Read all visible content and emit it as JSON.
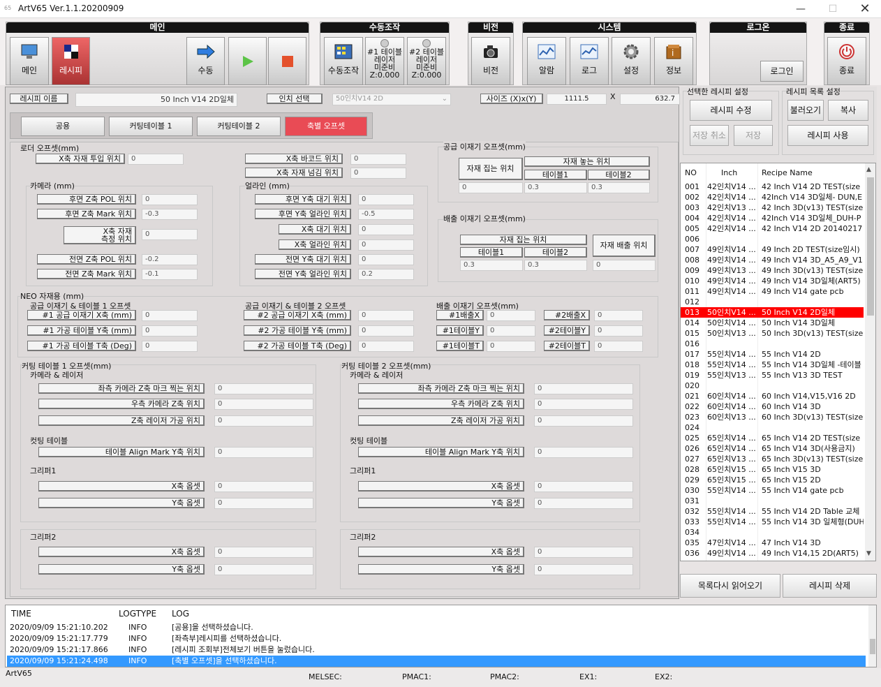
{
  "window": {
    "title": "ArtV65 Ver.1.1.20200909",
    "icon_text": "65"
  },
  "toolbar": {
    "main": {
      "header": "메인",
      "buttons": [
        "메인",
        "레시피",
        "수동"
      ]
    },
    "manual": {
      "header": "수동조작",
      "btn": "수동조작",
      "t1": [
        "#1 테이블",
        "레이저",
        "미준비",
        "Z:0.000"
      ],
      "t2": [
        "#2 테이블",
        "레이저",
        "미준비",
        "Z:0.000"
      ]
    },
    "vision": {
      "header": "비전",
      "btn": "비전"
    },
    "system": {
      "header": "시스템",
      "buttons": [
        "알람",
        "로그",
        "설정",
        "정보"
      ]
    },
    "login": {
      "header": "로그온",
      "btn": "로그인"
    },
    "exit": {
      "header": "종료",
      "btn": "종료"
    }
  },
  "recipe": {
    "name_label": "레시피 이름",
    "name_value": "50 Inch V14 2D일체",
    "inch_label": "인치 선택",
    "inch_value": "50인치V14 2D",
    "size_label": "사이즈 (X)x(Y)",
    "size_x": "1111.5",
    "size_sep": "X",
    "size_y": "632.7"
  },
  "tabs": [
    "공용",
    "커팅테이블 1",
    "커팅테이블 2",
    "축별 오프셋"
  ],
  "loader": {
    "title": "로더 오프셋(mm)",
    "x_in": "X축 자재 투입 위치",
    "x_in_v": "0",
    "x_bc": "X축 바코드 위치",
    "x_bc_v": "0",
    "x_pass": "X축 자재 넘김 위치",
    "x_pass_v": "0"
  },
  "camera": {
    "title": "카메라 (mm)",
    "rows": [
      {
        "l": "후면 Z축 POL 위치",
        "v": "0"
      },
      {
        "l": "후면 Z축 Mark 위치",
        "v": "-0.3"
      },
      {
        "l": "X축 자재\n측정 위치",
        "v": "0"
      },
      {
        "l": "전면 Z축 POL 위치",
        "v": "-0.2"
      },
      {
        "l": "전면 Z축 Mark 위치",
        "v": "-0.1"
      }
    ]
  },
  "align": {
    "title": "얼라인 (mm)",
    "rows": [
      {
        "l": "후면 Y축 대기 위치",
        "v": "0"
      },
      {
        "l": "후면 Y축 얼라인 위치",
        "v": "-0.5"
      },
      {
        "l": "X축 대기 위치",
        "v": "0"
      },
      {
        "l": "X축 얼라인 위치",
        "v": "0"
      },
      {
        "l": "전면 Y축 대기 위치",
        "v": "0"
      },
      {
        "l": "전면 Y축 얼라인 위치",
        "v": "0.2"
      }
    ]
  },
  "supply": {
    "title": "공급 이재기 오프셋(mm)",
    "pick": "자재 집는 위치",
    "place": "자재 놓는 위치",
    "t1": "테이블1",
    "t2": "테이블2",
    "v": [
      "0",
      "0.3",
      "0.3"
    ]
  },
  "unload": {
    "title": "배출 이재기 오프셋(mm)",
    "pick": "자재 집는 위치",
    "out": "자재 배출 위치",
    "t1": "테이블1",
    "t2": "테이블2",
    "v": [
      "0.3",
      "0.3",
      "0"
    ]
  },
  "neo": {
    "title": "NEO 자재용 (mm)",
    "g1": "공급 이재기 & 테이블 1 오프셋",
    "g1_rows": [
      {
        "l": "#1 공급 이재기 X축 (mm)",
        "v": "0"
      },
      {
        "l": "#1 가공 테이블 Y축 (mm)",
        "v": "0"
      },
      {
        "l": "#1 가공 테이블 T축 (Deg)",
        "v": "0"
      }
    ],
    "g2": "공급 이재기 & 테이블 2 오프셋",
    "g2_rows": [
      {
        "l": "#2 공급 이재기 X축 (mm)",
        "v": "0"
      },
      {
        "l": "#2 가공 테이블 Y축 (mm)",
        "v": "0"
      },
      {
        "l": "#2 가공 테이블 T축 (Deg)",
        "v": "0"
      }
    ],
    "g3": "배출 이재기 오프셋(mm)",
    "g3_rows": [
      {
        "l": "#1배출X",
        "v": "0",
        "l2": "#2배출X",
        "v2": "0"
      },
      {
        "l": "#1테이블Y",
        "v": "0",
        "l2": "#2테이블Y",
        "v2": "0"
      },
      {
        "l": "#1테이블T",
        "v": "0",
        "l2": "#2테이블T",
        "v2": "0"
      }
    ]
  },
  "ct": [
    {
      "title": "커팅 테이블 1 오프셋(mm)",
      "cam": "카메라 & 레이저",
      "r1": "좌측 카메라 Z축 마크 찍는 위치",
      "r2": "우측 카메라 Z축 위치",
      "r3": "Z축 레이저 가공 위치",
      "cut": "컷팅 테이블",
      "r4": "테이블 Align Mark Y축 위치",
      "g1": "그리퍼1",
      "g2": "그리퍼2",
      "xo": "X축 옵셋",
      "yo": "Y축 옵셋",
      "v": "0"
    },
    {
      "title": "커팅 테이블 2 오프셋(mm)",
      "cam": "카메라 & 레이저",
      "r1": "좌측 카메라 Z축 마크 찍는 위치",
      "r2": "우측 카메라 Z축 위치",
      "r3": "Z축 레이저 가공 위치",
      "cut": "컷팅 테이블",
      "r4": "테이블 Align Mark Y축 위치",
      "g1": "그리퍼1",
      "g2": "그리퍼2",
      "xo": "X축 옵셋",
      "yo": "Y축 옵셋",
      "v": "0"
    }
  ],
  "right": {
    "sel_title": "선택한 레시피 설정",
    "edit": "레시피 수정",
    "cancel": "저장 취소",
    "save": "저장",
    "list_title": "레시피 목록 설정",
    "load": "불러오기",
    "copy": "복사",
    "use": "레시피 사용",
    "reload": "목록다시 읽어오기",
    "delete": "레시피 삭제",
    "cols": [
      "NO",
      "Inch",
      "Recipe Name"
    ],
    "rows": [
      [
        "001",
        "42인치V14 ...",
        "42 Inch V14 2D TEST(size"
      ],
      [
        "002",
        "42인치V14 ...",
        "42Inch V14 3D일체- DUN,E"
      ],
      [
        "003",
        "42인치V13 ...",
        "42 Inch 3D(v13) TEST(size"
      ],
      [
        "004",
        "42인치V14 ...",
        "42Inch V14 3D일체_DUH-P"
      ],
      [
        "005",
        "42인치V14 ...",
        "42 Inch V14 2D 20140217"
      ],
      [
        "006",
        "",
        ""
      ],
      [
        "007",
        "49인치V14 ...",
        "49 Inch 2D TEST(size임시)"
      ],
      [
        "008",
        "49인치V14 ...",
        "49 Inch V14 3D_A5_A9_V1"
      ],
      [
        "009",
        "49인치V13 ...",
        "49 Inch 3D(v13) TEST(size"
      ],
      [
        "010",
        "49인치V14 ...",
        "49 Inch V14 3D일체(ART5)"
      ],
      [
        "011",
        "49인치V14 ...",
        "49 Inch V14 gate pcb"
      ],
      [
        "012",
        "",
        ""
      ],
      [
        "013",
        "50인치V14 ...",
        "50 Inch V14 2D일체"
      ],
      [
        "014",
        "50인치V14 ...",
        "50 Inch V14 3D일체"
      ],
      [
        "015",
        "50인치V13 ...",
        "50 Inch 3D(v13) TEST(size"
      ],
      [
        "016",
        "",
        ""
      ],
      [
        "017",
        "55인치V14 ...",
        "55 Inch V14 2D"
      ],
      [
        "018",
        "55인치V14 ...",
        "55 Inch V14 3D일체 -테이블"
      ],
      [
        "019",
        "55인치V13 ...",
        "55 Inch V13 3D TEST"
      ],
      [
        "020",
        "",
        ""
      ],
      [
        "021",
        "60인치V14 ...",
        "60 Inch V14,V15,V16 2D"
      ],
      [
        "022",
        "60인치V14 ...",
        "60 Inch V14 3D"
      ],
      [
        "023",
        "60인치V13 ...",
        "60 Inch 3D(v13) TEST(size"
      ],
      [
        "024",
        "",
        ""
      ],
      [
        "025",
        "65인치V14 ...",
        "65 Inch V14 2D TEST(size"
      ],
      [
        "026",
        "65인치V14 ...",
        "65 Inch V14 3D(사용금지)"
      ],
      [
        "027",
        "65인치V13 ...",
        "65 Inch 3D(v13) TEST(size"
      ],
      [
        "028",
        "65인치V15 ...",
        "65 Inch V15 3D"
      ],
      [
        "029",
        "65인치V15 ...",
        "65 Inch V15 2D"
      ],
      [
        "030",
        "55인치V14 ...",
        "55 Inch V14 gate pcb"
      ],
      [
        "031",
        "",
        ""
      ],
      [
        "032",
        "55인치V14 ...",
        "55 Inch V14 2D Table 교체"
      ],
      [
        "033",
        "55인치V14 ...",
        "55 Inch V14 3D 일체형(DUH"
      ],
      [
        "034",
        "",
        ""
      ],
      [
        "035",
        "47인치V14 ...",
        "47 Inch V14 3D"
      ],
      [
        "036",
        "49인치V14 ...",
        "49 Inch V14,15 2D(ART5)"
      ]
    ]
  },
  "log": {
    "cols": [
      "TIME",
      "LOGTYPE",
      "LOG"
    ],
    "rows": [
      [
        "2020/09/09 15:21:10.202",
        "INFO",
        "[공용]을 선택하셨습니다."
      ],
      [
        "2020/09/09 15:21:17.779",
        "INFO",
        "[좌측부]레시피를 선택하셨습니다."
      ],
      [
        "2020/09/09 15:21:17.866",
        "INFO",
        "[레시피 조회부]전체보기 버튼을 눌렀습니다."
      ],
      [
        "2020/09/09 15:21:24.498",
        "INFO",
        "[축별 오프셋]을 선택하셨습니다."
      ]
    ]
  },
  "status": {
    "app": "ArtV65",
    "melsec": "MELSEC:",
    "pmac1": "PMAC1:",
    "pmac2": "PMAC2:",
    "ex1": "EX1:",
    "ex2": "EX2:"
  },
  "colors": {
    "accent_red": "#e94b55",
    "selected_row": "#ff0000",
    "log_selected": "#3399ff"
  }
}
